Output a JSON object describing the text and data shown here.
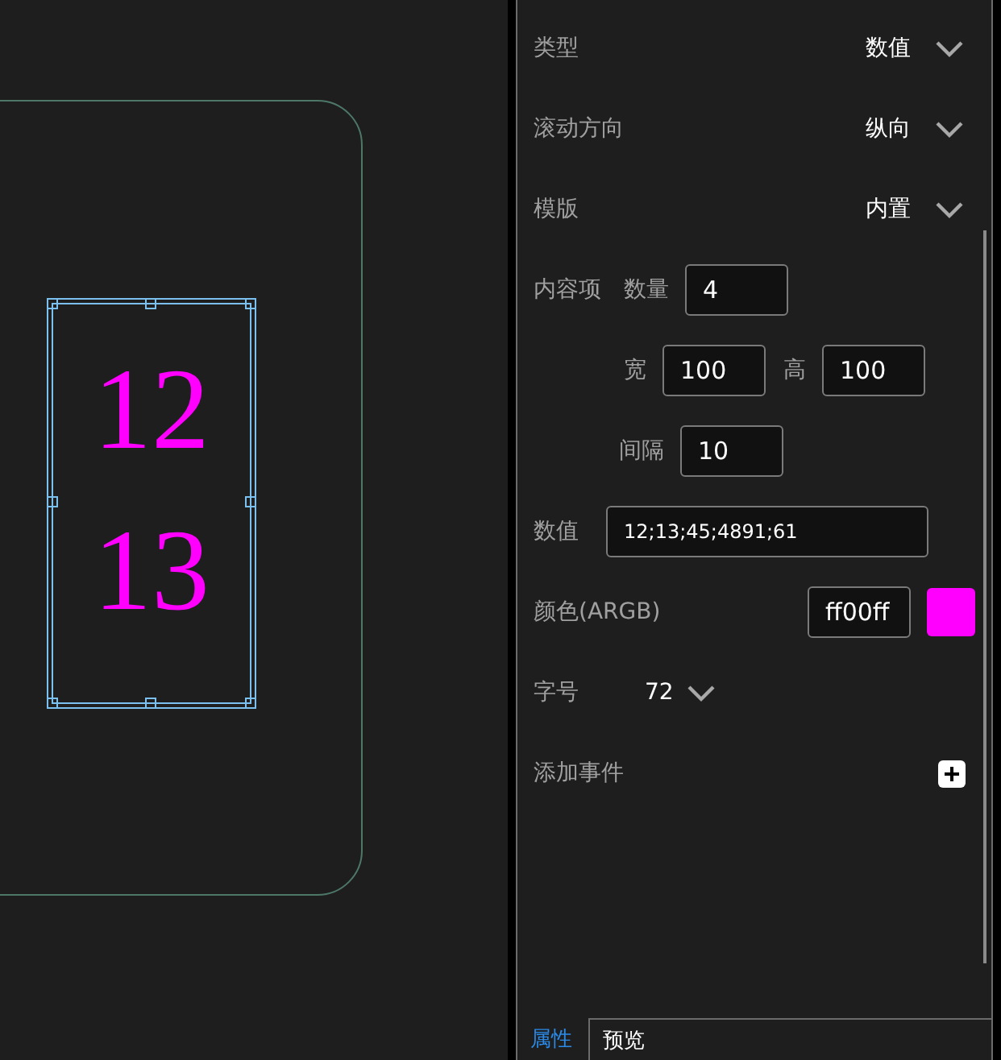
{
  "canvas": {
    "numbers": [
      "12",
      "13"
    ]
  },
  "properties": [
    {
      "kind": "dropdown",
      "label": "类型",
      "value": "数值"
    },
    {
      "kind": "dropdown",
      "label": "滚动方向",
      "value": "纵向"
    },
    {
      "kind": "dropdown",
      "label": "模版",
      "value": "内置"
    },
    {
      "kind": "fields",
      "label": "内容项",
      "fields": [
        {
          "label": "数量",
          "value": "4"
        }
      ]
    },
    {
      "kind": "fields",
      "fields": [
        {
          "label": "宽",
          "value": "100"
        },
        {
          "label": "高",
          "value": "100"
        }
      ]
    },
    {
      "kind": "fields",
      "fields": [
        {
          "label": "间隔",
          "value": "10"
        }
      ]
    },
    {
      "kind": "text",
      "label": "数值",
      "value": "12;13;45;4891;61"
    },
    {
      "kind": "color",
      "label": "颜色(ARGB)",
      "value": "ff00ff",
      "color": "#ff00ff"
    },
    {
      "kind": "size",
      "label": "字号",
      "value": "72"
    },
    {
      "kind": "action",
      "label": "添加事件"
    }
  ],
  "tabs": [
    {
      "label": "属性",
      "selected": true
    },
    {
      "label": "预览",
      "selected": false
    }
  ]
}
